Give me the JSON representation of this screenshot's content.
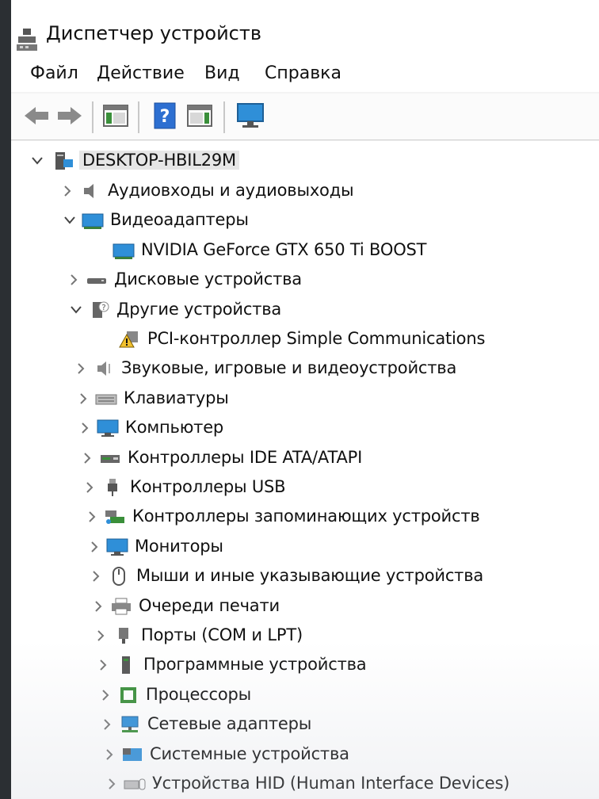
{
  "window": {
    "title": "Диспетчер устройств",
    "app_icon": "device-manager-icon"
  },
  "menu": {
    "items": [
      {
        "label": "Файл"
      },
      {
        "label": "Действие"
      },
      {
        "label": "Вид"
      },
      {
        "label": "Справка"
      }
    ]
  },
  "toolbar": {
    "buttons": [
      {
        "icon": "back-arrow-icon"
      },
      {
        "icon": "forward-arrow-icon"
      },
      {
        "icon": "properties-panel-icon"
      },
      {
        "icon": "help-icon"
      },
      {
        "icon": "console-tree-icon"
      },
      {
        "icon": "scan-hardware-monitor-icon"
      }
    ]
  },
  "tree": {
    "root": {
      "label": "DESKTOP-HBIL29M",
      "icon": "computer-icon",
      "expanded": true
    },
    "items": [
      {
        "label": "Аудиовходы и аудиовыходы",
        "icon": "speaker-icon",
        "expanded": false
      },
      {
        "label": "Видеоадаптеры",
        "icon": "display-adapter-icon",
        "expanded": true
      },
      {
        "label": "NVIDIA GeForce GTX 650 Ti BOOST",
        "icon": "display-adapter-icon",
        "child": true
      },
      {
        "label": "Дисковые устройства",
        "icon": "disk-drive-icon",
        "expanded": false
      },
      {
        "label": "Другие устройства",
        "icon": "unknown-device-icon",
        "expanded": true
      },
      {
        "label": "PCI-контроллер Simple Communications",
        "icon": "warning-device-icon",
        "child": true
      },
      {
        "label": "Звуковые, игровые и видеоустройства",
        "icon": "sound-icon",
        "expanded": false
      },
      {
        "label": "Клавиатуры",
        "icon": "keyboard-icon",
        "expanded": false
      },
      {
        "label": "Компьютер",
        "icon": "monitor-icon",
        "expanded": false
      },
      {
        "label": "Контроллеры IDE ATA/ATAPI",
        "icon": "ide-controller-icon",
        "expanded": false
      },
      {
        "label": "Контроллеры USB",
        "icon": "usb-icon",
        "expanded": false
      },
      {
        "label": "Контроллеры запоминающих устройств",
        "icon": "storage-controller-icon",
        "expanded": false
      },
      {
        "label": "Мониторы",
        "icon": "monitor-icon",
        "expanded": false
      },
      {
        "label": "Мыши и иные указывающие устройства",
        "icon": "mouse-icon",
        "expanded": false
      },
      {
        "label": "Очереди печати",
        "icon": "printer-icon",
        "expanded": false
      },
      {
        "label": "Порты (COM и LPT)",
        "icon": "port-icon",
        "expanded": false
      },
      {
        "label": "Программные устройства",
        "icon": "software-device-icon",
        "expanded": false
      },
      {
        "label": "Процессоры",
        "icon": "processor-icon",
        "expanded": false
      },
      {
        "label": "Сетевые адаптеры",
        "icon": "network-adapter-icon",
        "expanded": false
      },
      {
        "label": "Системные устройства",
        "icon": "system-device-icon",
        "expanded": false
      },
      {
        "label": "Устройства HID (Human Interface Devices)",
        "icon": "hid-icon",
        "expanded": false
      }
    ]
  },
  "colors": {
    "tree_bg": "#ffffff",
    "root_highlight": "#e6e6e6",
    "icon_blue": "#2f8fd8",
    "help_blue": "#2d6fd1",
    "warning_yellow": "#f2c12e"
  }
}
